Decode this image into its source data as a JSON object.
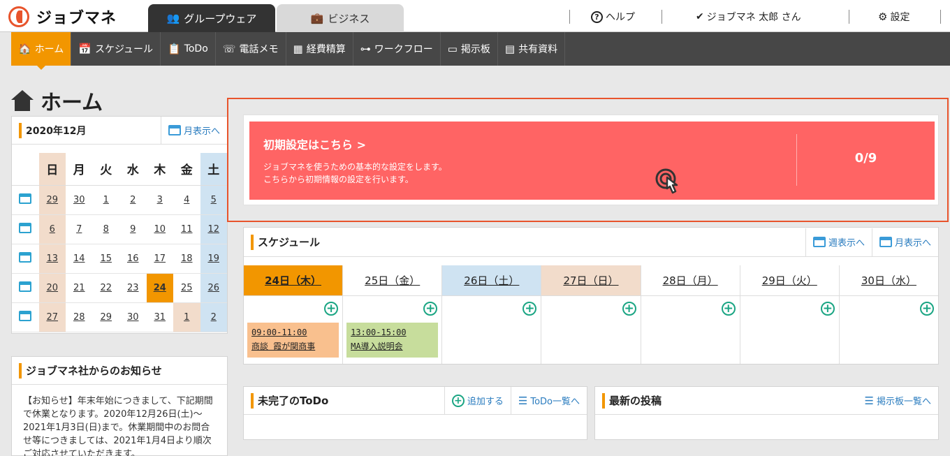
{
  "app": {
    "logo": "ジョブマネ"
  },
  "app_tabs": [
    {
      "label": "グループウェア",
      "icon": "group-icon"
    },
    {
      "label": "ビジネス",
      "icon": "briefcase-icon"
    }
  ],
  "header": {
    "help": "ヘルプ",
    "user": "ジョブマネ 太郎 さん",
    "settings": "設定"
  },
  "nav": [
    {
      "label": "ホーム",
      "icon": "home-icon"
    },
    {
      "label": "スケジュール",
      "icon": "calendar-icon"
    },
    {
      "label": "ToDo",
      "icon": "todo-icon"
    },
    {
      "label": "電話メモ",
      "icon": "phone-icon"
    },
    {
      "label": "経費精算",
      "icon": "calculator-icon"
    },
    {
      "label": "ワークフロー",
      "icon": "workflow-icon"
    },
    {
      "label": "掲示板",
      "icon": "board-icon"
    },
    {
      "label": "共有資料",
      "icon": "document-icon"
    }
  ],
  "page_title": "ホーム",
  "mini_calendar": {
    "title": "2020年12月",
    "month_link": "月表示へ",
    "weekdays": [
      "日",
      "月",
      "火",
      "水",
      "木",
      "金",
      "土"
    ],
    "weeks": [
      [
        "29",
        "30",
        "1",
        "2",
        "3",
        "4",
        "5"
      ],
      [
        "6",
        "7",
        "8",
        "9",
        "10",
        "11",
        "12"
      ],
      [
        "13",
        "14",
        "15",
        "16",
        "17",
        "18",
        "19"
      ],
      [
        "20",
        "21",
        "22",
        "23",
        "24",
        "25",
        "26"
      ],
      [
        "27",
        "28",
        "29",
        "30",
        "31",
        "1",
        "2"
      ]
    ],
    "today": "24"
  },
  "news": {
    "title": "ジョブマネ社からのお知らせ",
    "body": "【お知らせ】年末年始につきまして、下記期間で休業となります。2020年12月26日(土)〜2021年1月3日(日)まで。休業期間中のお問合せ等につきましては、2021年1月4日より順次ご対応させていただきます。"
  },
  "setup": {
    "title": "初期設定はこちら >",
    "desc_line1": "ジョブマネを使うための基本的な設定をします。",
    "desc_line2": "こちらから初期情報の設定を行います。",
    "progress": "0/9"
  },
  "schedule": {
    "title": "スケジュール",
    "week_link": "週表示へ",
    "month_link": "月表示へ",
    "days": [
      {
        "label": "24日（木）",
        "kind": "today"
      },
      {
        "label": "25日（金）",
        "kind": "normal"
      },
      {
        "label": "26日（土）",
        "kind": "sat"
      },
      {
        "label": "27日（日）",
        "kind": "sun"
      },
      {
        "label": "28日（月）",
        "kind": "normal"
      },
      {
        "label": "29日（火）",
        "kind": "normal"
      },
      {
        "label": "30日（水）",
        "kind": "normal"
      }
    ],
    "events": [
      {
        "time": "09:00-11:00",
        "title": "商談 霞が関商事"
      },
      {
        "time": "13:00-15:00",
        "title": "MA導入説明会"
      }
    ]
  },
  "todo": {
    "title": "未完了のToDo",
    "add": "追加する",
    "list_link": "ToDo一覧へ"
  },
  "posts": {
    "title": "最新の投稿",
    "list_link": "掲示板一覧へ"
  },
  "colors": {
    "accent": "#f29600",
    "nav_bg": "#474747",
    "setup_bg": "#ff6464",
    "highlight_border": "#e8542c"
  }
}
